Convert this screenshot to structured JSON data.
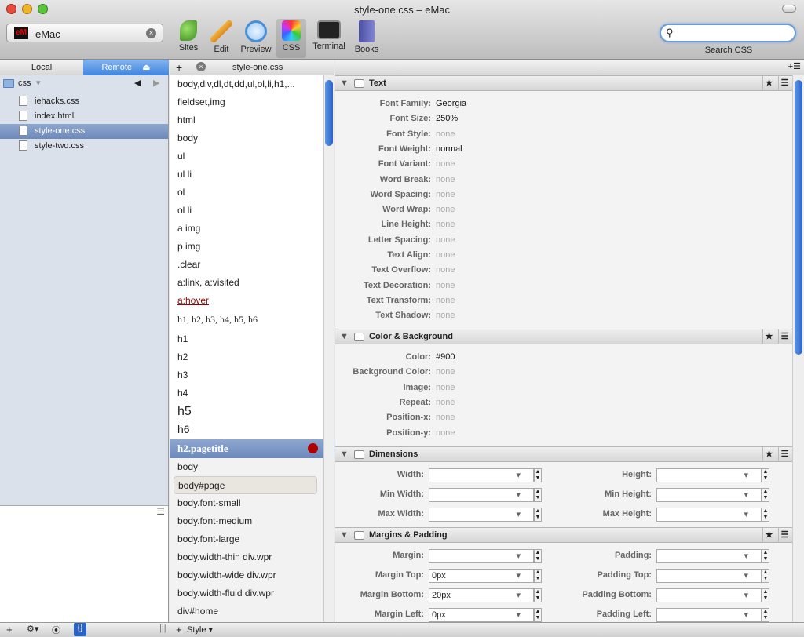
{
  "window": {
    "title": "style-one.css – eMac"
  },
  "site": {
    "logo": "eM",
    "name": "eMac"
  },
  "toolbar": {
    "sites": "Sites",
    "edit": "Edit",
    "preview": "Preview",
    "css": "CSS",
    "terminal": "Terminal",
    "books": "Books"
  },
  "search": {
    "label": "Search CSS",
    "value": ""
  },
  "left": {
    "tab_local": "Local",
    "tab_remote": "Remote",
    "folder": "css",
    "files": [
      "iehacks.css",
      "index.html",
      "style-one.css",
      "style-two.css"
    ],
    "selected_file": "style-one.css"
  },
  "doc_tab": {
    "title": "style-one.css"
  },
  "selectors": [
    "body,div,dl,dt,dd,ul,ol,li,h1,...",
    "fieldset,img",
    "html",
    "body",
    "ul",
    "ul li",
    "ol",
    "ol li",
    "a img",
    "p img",
    ".clear",
    "a:link, a:visited",
    "a:hover",
    "h1, h2, h3, h4, h5, h6",
    "h1",
    "h2",
    "h3",
    "h4",
    "h5",
    "h6"
  ],
  "selected_selector": "h2.pagetitle",
  "selectors_after": [
    "body",
    "body#page",
    "body.font-small",
    "body.font-medium",
    "body.font-large",
    "body.width-thin div.wpr",
    "body.width-wide div.wpr",
    "body.width-fluid div.wpr",
    "div#home"
  ],
  "sections": {
    "text": "Text",
    "color": "Color & Background",
    "dimensions": "Dimensions",
    "margins": "Margins & Padding"
  },
  "text_props": [
    {
      "label": "Font Family:",
      "value": "Georgia"
    },
    {
      "label": "Font Size:",
      "value": "250%"
    },
    {
      "label": "Font Style:",
      "value": "none"
    },
    {
      "label": "Font Weight:",
      "value": "normal"
    },
    {
      "label": "Font Variant:",
      "value": "none"
    },
    {
      "label": "Word Break:",
      "value": "none"
    },
    {
      "label": "Word Spacing:",
      "value": "none"
    },
    {
      "label": "Word Wrap:",
      "value": "none"
    },
    {
      "label": "Line Height:",
      "value": "none"
    },
    {
      "label": "Letter Spacing:",
      "value": "none"
    },
    {
      "label": "Text Align:",
      "value": "none"
    },
    {
      "label": "Text Overflow:",
      "value": "none"
    },
    {
      "label": "Text Decoration:",
      "value": "none"
    },
    {
      "label": "Text Transform:",
      "value": "none"
    },
    {
      "label": "Text Shadow:",
      "value": "none"
    }
  ],
  "color_props": [
    {
      "label": "Color:",
      "value": "#900"
    },
    {
      "label": "Background Color:",
      "value": "none"
    },
    {
      "label": "Image:",
      "value": "none"
    },
    {
      "label": "Repeat:",
      "value": "none"
    },
    {
      "label": "Position-x:",
      "value": "none"
    },
    {
      "label": "Position-y:",
      "value": "none"
    }
  ],
  "dim_props": [
    {
      "left": "Width:",
      "right": "Height:"
    },
    {
      "left": "Min Width:",
      "right": "Min Height:"
    },
    {
      "left": "Max Width:",
      "right": "Max Height:"
    }
  ],
  "margin_props": [
    {
      "left": "Margin:",
      "lval": "",
      "right": "Padding:"
    },
    {
      "left": "Margin Top:",
      "lval": "0px",
      "right": "Padding Top:"
    },
    {
      "left": "Margin Bottom:",
      "lval": "20px",
      "right": "Padding Bottom:"
    },
    {
      "left": "Margin Left:",
      "lval": "0px",
      "right": "Padding Left:"
    }
  ],
  "bottom": {
    "style": "Style"
  },
  "colors": {
    "hover_link": "#900",
    "selected_dot": "#b00000",
    "accent": "#3f85de"
  }
}
